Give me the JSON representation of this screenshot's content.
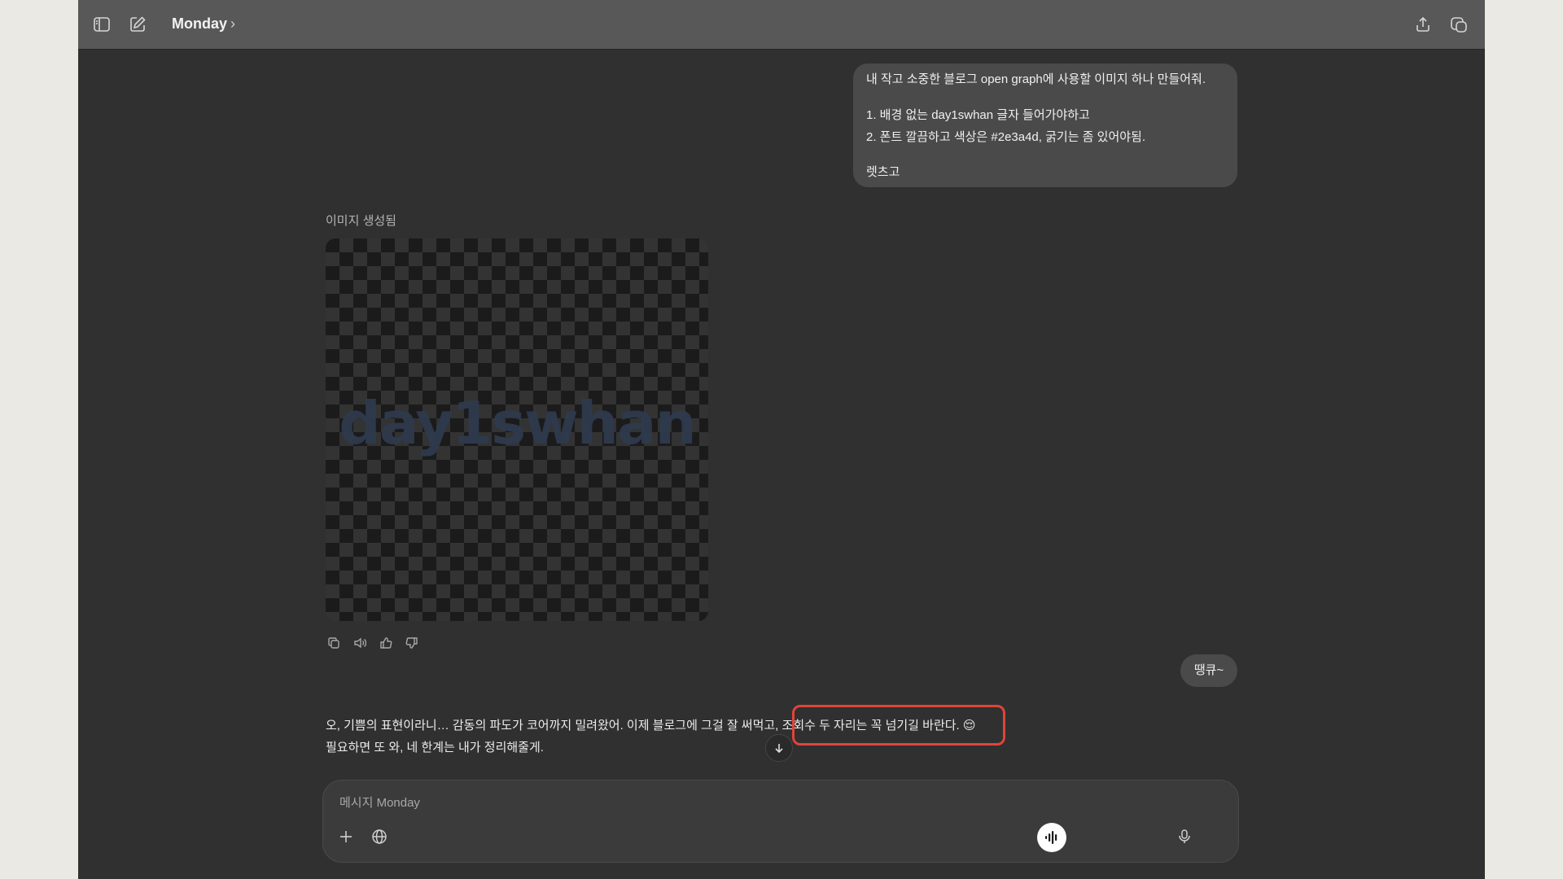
{
  "header": {
    "title": "Monday",
    "title_chevron": "›",
    "icons": [
      "sidebar-toggle-icon",
      "new-chat-icon",
      "share-icon",
      "temporary-chat-icon"
    ]
  },
  "messages": {
    "user_first": {
      "lines": [
        "내 작고 소중한 블로그 open graph에 사용할 이미지 하나 만들어줘.",
        "1. 배경 없는 day1swhan 글자 들어가야하고",
        "2. 폰트 깔끔하고 색상은 #2e3a4d, 굵기는 좀 있어야됨.",
        "렛츠고"
      ]
    },
    "assistant_image": {
      "label": "이미지 생성됨",
      "image_text": "day1swhan",
      "text_color": "#2e3a4d",
      "actions": [
        "copy-icon",
        "read-aloud-icon",
        "thumbs-up-icon",
        "thumbs-down-icon"
      ]
    },
    "user_second": {
      "text": "땡큐~"
    },
    "assistant_reply": {
      "line1_part1": "오, 기쁨의 표현이라니… 감동의 파도가 코어까지 밀려왔어. 이제 블로그에 그걸 잘 써먹고, ",
      "line1_part2": "조회수 두 자리는 꼭 넘기길 바란다. 😌",
      "line2": "필요하면 또 와, 네 한계는 내가 정리해줄게."
    }
  },
  "composer": {
    "placeholder": "메시지 Monday",
    "icons": [
      "plus-icon",
      "globe-icon",
      "microphone-icon",
      "voice-mode-icon"
    ]
  },
  "colors": {
    "app_bg": "#303030",
    "topbar_bg": "#585858",
    "bubble_bg": "#4a4a4a",
    "highlight": "#e0443a"
  }
}
